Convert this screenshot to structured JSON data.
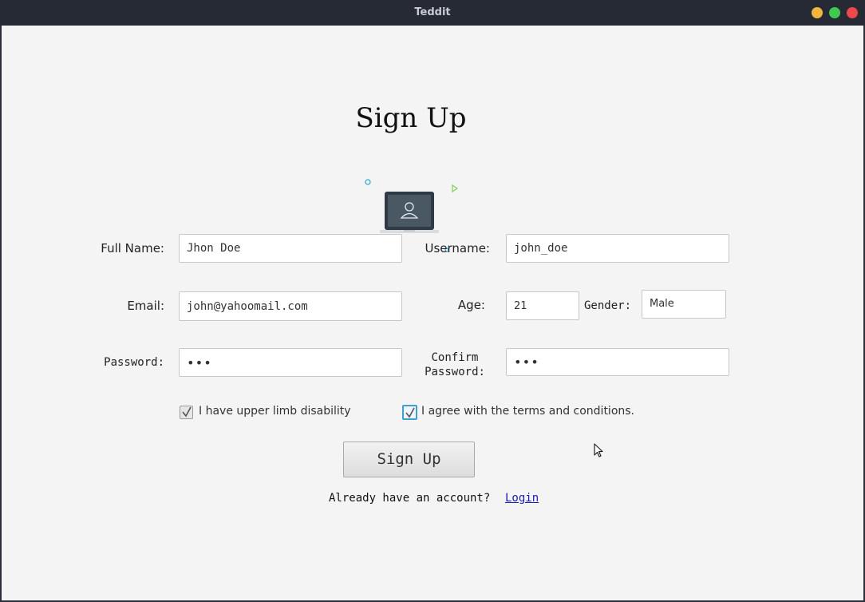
{
  "window": {
    "title": "Teddit"
  },
  "form": {
    "heading": "Sign Up",
    "full_name": {
      "label": "Full Name:",
      "value": "Jhon Doe"
    },
    "username": {
      "label": "Username:",
      "value": "john_doe"
    },
    "email": {
      "label": "Email:",
      "value": "john@yahoomail.com"
    },
    "age": {
      "label": "Age:",
      "value": "21"
    },
    "gender": {
      "label": "Gender:",
      "value": "Male"
    },
    "password": {
      "label": "Password:",
      "value": "•••"
    },
    "confirm_password": {
      "label_line1": "Confirm",
      "label_line2": "Password:",
      "value": "•••"
    },
    "disability_checkbox": {
      "label": "I have upper limb disability",
      "checked": true
    },
    "terms_checkbox": {
      "label": "I agree with the terms and conditions.",
      "checked": true
    },
    "submit_label": "Sign Up",
    "account_prompt": "Already have an account?",
    "login_link": "Login"
  },
  "icons": {
    "illustration": "user-laptop-icon",
    "checkbox_check": "checkmark-icon",
    "cursor": "mouse-pointer-icon"
  },
  "colors": {
    "titlebar": "#252a35",
    "background": "#f4f4f4",
    "link": "#1a1ab8",
    "focus": "#3f9fd1",
    "close": "#ee4848",
    "minimize": "#f4b63f",
    "maximize": "#3fc950"
  }
}
